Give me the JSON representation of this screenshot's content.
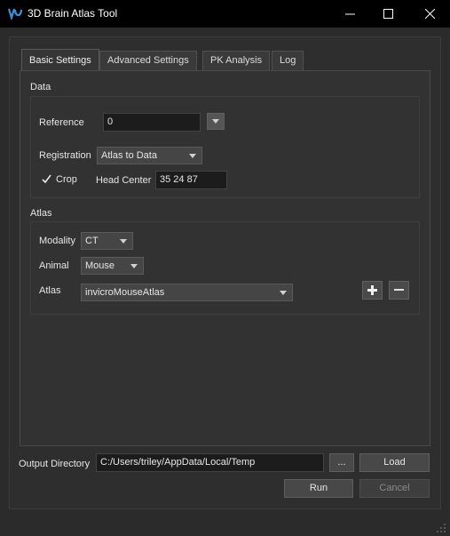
{
  "window": {
    "title": "3D Brain Atlas Tool",
    "minimize_icon": "minimize-icon",
    "maximize_icon": "maximize-icon",
    "close_icon": "close-icon"
  },
  "tabs": [
    {
      "label": "Basic Settings",
      "active": true
    },
    {
      "label": "Advanced Settings",
      "active": false
    },
    {
      "label": "PK Analysis",
      "active": false
    },
    {
      "label": "Log",
      "active": false
    }
  ],
  "data_group": {
    "title": "Data",
    "reference_label": "Reference",
    "reference_value": "0",
    "registration_label": "Registration",
    "registration_value": "Atlas to Data",
    "crop_label": "Crop",
    "crop_checked": true,
    "head_center_label": "Head Center",
    "head_center_value": "35 24 87"
  },
  "atlas_group": {
    "title": "Atlas",
    "modality_label": "Modality",
    "modality_value": "CT",
    "animal_label": "Animal",
    "animal_value": "Mouse",
    "atlas_label": "Atlas",
    "atlas_value": "invicroMouseAtlas"
  },
  "bottom": {
    "output_directory_label": "Output Directory",
    "output_directory_value": "C:/Users/triley/AppData/Local/Temp",
    "browse_label": "...",
    "load_label": "Load",
    "run_label": "Run",
    "cancel_label": "Cancel"
  },
  "colors": {
    "titlebar": "#000000",
    "background": "#2b2b2b",
    "accent_icon": "#3d8fd6"
  }
}
